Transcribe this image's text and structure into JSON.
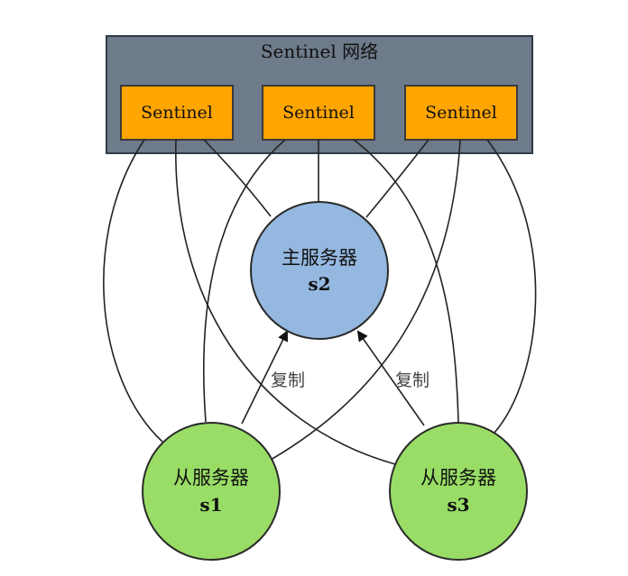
{
  "network": {
    "title": "Sentinel 网络",
    "sentinels": [
      {
        "label": "Sentinel"
      },
      {
        "label": "Sentinel"
      },
      {
        "label": "Sentinel"
      }
    ]
  },
  "master": {
    "name": "主服务器",
    "id": "s2"
  },
  "slaves": [
    {
      "name": "从服务器",
      "id": "s1"
    },
    {
      "name": "从服务器",
      "id": "s3"
    }
  ],
  "edges": {
    "replication_label": "复制"
  },
  "colors": {
    "network_bg": "#6e7b8b",
    "sentinel": "#ffa500",
    "master": "#94b8e0",
    "slave": "#99dd66"
  }
}
